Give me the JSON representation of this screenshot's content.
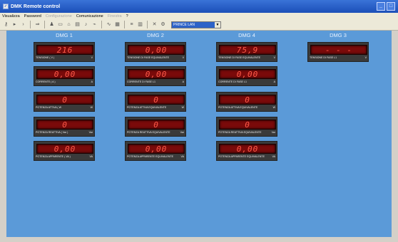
{
  "window": {
    "title": "DMK Remote control"
  },
  "menu": [
    {
      "label": "Visualizza",
      "enabled": true
    },
    {
      "label": "Password",
      "enabled": true
    },
    {
      "label": "Configurazione",
      "enabled": false
    },
    {
      "label": "Comunicazione",
      "enabled": true
    },
    {
      "label": "Finestra",
      "enabled": false
    },
    {
      "label": "?",
      "enabled": true
    }
  ],
  "toolbar": {
    "connection_value": "PRINCE LAN"
  },
  "columns": [
    {
      "title": "DMG 1",
      "meters": [
        {
          "value": "216",
          "label": "TENSIONE ( V )",
          "unit": "V"
        },
        {
          "value": "0,00",
          "label": "CORRENTE ( A )",
          "unit": "A"
        },
        {
          "value": "0",
          "label": "POTENZA ATTIVA ( W",
          "unit": "W"
        },
        {
          "value": "0",
          "label": "POTENZA REATTIVA ( Var )",
          "unit": "Var"
        },
        {
          "value": "0,00",
          "label": "POTENZA APPARENTE ( VA )",
          "unit": "VA"
        }
      ]
    },
    {
      "title": "DMG 2",
      "meters": [
        {
          "value": "0,00",
          "label": "TENSIONE DI FASE EQUIVALENTE",
          "unit": "V"
        },
        {
          "value": "0,00",
          "label": "CORRENTE DI FASE L1",
          "unit": "A"
        },
        {
          "value": "0",
          "label": "POTENZA ATTIVA EQUIVALENTE",
          "unit": "W"
        },
        {
          "value": "0",
          "label": "POTENZA REATTIVA EQUIVALENTE",
          "unit": "Var"
        },
        {
          "value": "0,00",
          "label": "POTENZA APPARENTE EQUIVALENTE",
          "unit": "VA"
        }
      ]
    },
    {
      "title": "DMG 4",
      "meters": [
        {
          "value": "75,9",
          "label": "TENSIONE DI FASE EQUIVALENTE",
          "unit": "V"
        },
        {
          "value": "0,00",
          "label": "CORRENTE DI FASE L1",
          "unit": "A"
        },
        {
          "value": "0",
          "label": "POTENZA ATTIVA EQUIVALENTE",
          "unit": "W"
        },
        {
          "value": "0",
          "label": "POTENZA REATTIVA EQUIVALENTE",
          "unit": "Var"
        },
        {
          "value": "0,00",
          "label": "POTENZA APPARENTE EQUIVALENTE",
          "unit": "VA"
        }
      ]
    },
    {
      "title": "DMG 3",
      "meters": [
        {
          "value": "- - -",
          "label": "TENSIONE DI FASE L1",
          "unit": "V"
        }
      ]
    }
  ]
}
